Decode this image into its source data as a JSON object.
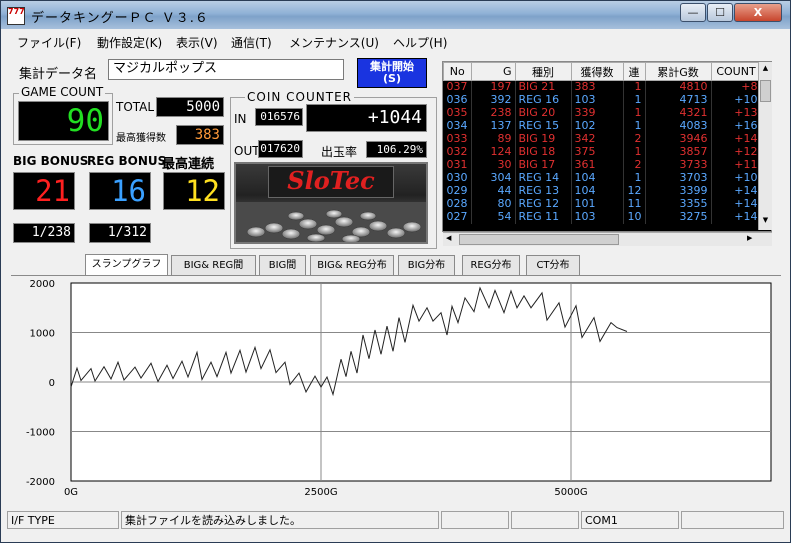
{
  "window": {
    "title": "データキングーＰＣ Ｖ３.６",
    "minimize": "—",
    "maximize": "☐",
    "close": "X"
  },
  "menu": [
    "ファイル(F)",
    "動作設定(K)",
    "表示(V)",
    "通信(T)",
    "メンテナンス(U)",
    "ヘルプ(H)"
  ],
  "summary": {
    "label": "集計データ名",
    "name_value": "マジカルポップス",
    "start_button_line1": "集計開始",
    "start_button_line2": "(S)"
  },
  "game_count": {
    "title": "GAME COUNT",
    "value": "90",
    "total_label": "TOTAL",
    "total_value": "5000",
    "max_label": "最高獲得数",
    "max_value": "383"
  },
  "bonus": {
    "big_label": "BIG BONUS",
    "big_value": "21",
    "reg_label": "REG BONUS",
    "reg_value": "16",
    "streak_label": "最高連続",
    "streak_value": "12",
    "big_ratio": "1/238",
    "reg_ratio": "1/312"
  },
  "coin_counter": {
    "title": "COIN COUNTER",
    "in_label": "IN",
    "in_value": "016576",
    "diff_value": "+1044",
    "out_label": "OUT",
    "out_value": "017620",
    "rate_label": "出玉率",
    "rate_value": "106.29%",
    "logo": "SloTec"
  },
  "table": {
    "headers": [
      "No",
      "G",
      "種別",
      "獲得数",
      "連",
      "累計G数",
      "COUNT"
    ],
    "rows": [
      {
        "no": "037",
        "g": "197",
        "type": "BIG 21",
        "gain": "383",
        "streak": "1",
        "total": "4810",
        "count": "+8",
        "kind": "big"
      },
      {
        "no": "036",
        "g": "392",
        "type": "REG 16",
        "gain": "103",
        "streak": "1",
        "total": "4713",
        "count": "+10",
        "kind": "reg"
      },
      {
        "no": "035",
        "g": "238",
        "type": "BIG 20",
        "gain": "339",
        "streak": "1",
        "total": "4321",
        "count": "+13",
        "kind": "big"
      },
      {
        "no": "034",
        "g": "137",
        "type": "REG 15",
        "gain": "102",
        "streak": "1",
        "total": "4083",
        "count": "+16",
        "kind": "reg"
      },
      {
        "no": "033",
        "g": "89",
        "type": "BIG 19",
        "gain": "342",
        "streak": "2",
        "total": "3946",
        "count": "+14",
        "kind": "big"
      },
      {
        "no": "032",
        "g": "124",
        "type": "BIG 18",
        "gain": "375",
        "streak": "1",
        "total": "3857",
        "count": "+12",
        "kind": "big"
      },
      {
        "no": "031",
        "g": "30",
        "type": "BIG 17",
        "gain": "361",
        "streak": "2",
        "total": "3733",
        "count": "+11",
        "kind": "big"
      },
      {
        "no": "030",
        "g": "304",
        "type": "REG 14",
        "gain": "104",
        "streak": "1",
        "total": "3703",
        "count": "+10",
        "kind": "reg"
      },
      {
        "no": "029",
        "g": "44",
        "type": "REG 13",
        "gain": "104",
        "streak": "12",
        "total": "3399",
        "count": "+14",
        "kind": "reg"
      },
      {
        "no": "028",
        "g": "80",
        "type": "REG 12",
        "gain": "101",
        "streak": "11",
        "total": "3355",
        "count": "+14",
        "kind": "reg"
      },
      {
        "no": "027",
        "g": "54",
        "type": "REG 11",
        "gain": "103",
        "streak": "10",
        "total": "3275",
        "count": "+14",
        "kind": "reg"
      }
    ]
  },
  "tabs": [
    "スランプグラフ",
    "BIG& REG間",
    "BIG間",
    "BIG& REG分布",
    "BIG分布",
    "REG分布",
    "CT分布"
  ],
  "chart_data": {
    "type": "line",
    "xlim": [
      0,
      7000
    ],
    "ylim": [
      -2000,
      2000
    ],
    "yticks": [
      "2000",
      "1000",
      "0",
      "-1000",
      "-2000"
    ],
    "xticks": [
      "0G",
      "2500G",
      "5000G"
    ],
    "grid": true,
    "x": [
      0,
      60,
      100,
      200,
      240,
      330,
      400,
      470,
      530,
      640,
      700,
      800,
      870,
      960,
      1020,
      1110,
      1170,
      1260,
      1310,
      1400,
      1460,
      1550,
      1600,
      1690,
      1750,
      1840,
      1900,
      1990,
      2050,
      2140,
      2190,
      2280,
      2350,
      2440,
      2500,
      2560,
      2620,
      2700,
      2750,
      2800,
      2860,
      2920,
      2980,
      3040,
      3100,
      3160,
      3220,
      3280,
      3340,
      3420,
      3480,
      3560,
      3620,
      3700,
      3760,
      3810,
      3870,
      3940,
      4030,
      4090,
      4180,
      4240,
      4330,
      4400,
      4460,
      4530,
      4600,
      4710,
      4760,
      4880,
      4940,
      5050,
      5110,
      5230,
      5290,
      5400,
      5460,
      5560
    ],
    "y": [
      -100,
      280,
      30,
      270,
      20,
      310,
      60,
      400,
      40,
      300,
      80,
      380,
      10,
      340,
      70,
      420,
      100,
      600,
      50,
      400,
      110,
      600,
      180,
      640,
      200,
      700,
      270,
      650,
      190,
      400,
      -50,
      180,
      -200,
      120,
      -100,
      100,
      -250,
      460,
      110,
      620,
      180,
      950,
      470,
      1050,
      560,
      1130,
      620,
      1300,
      800,
      1550,
      1230,
      1500,
      1230,
      1400,
      950,
      1530,
      1200,
      1700,
      1420,
      1900,
      1500,
      1850,
      1400,
      1840,
      1500,
      1740,
      1500,
      1800,
      1250,
      1600,
      1110,
      1540,
      900,
      1300,
      820,
      1200,
      1100,
      1020
    ]
  },
  "status": {
    "if_type": "I/F TYPE",
    "message": "集計ファイルを読み込みしました。",
    "port": "COM1"
  }
}
